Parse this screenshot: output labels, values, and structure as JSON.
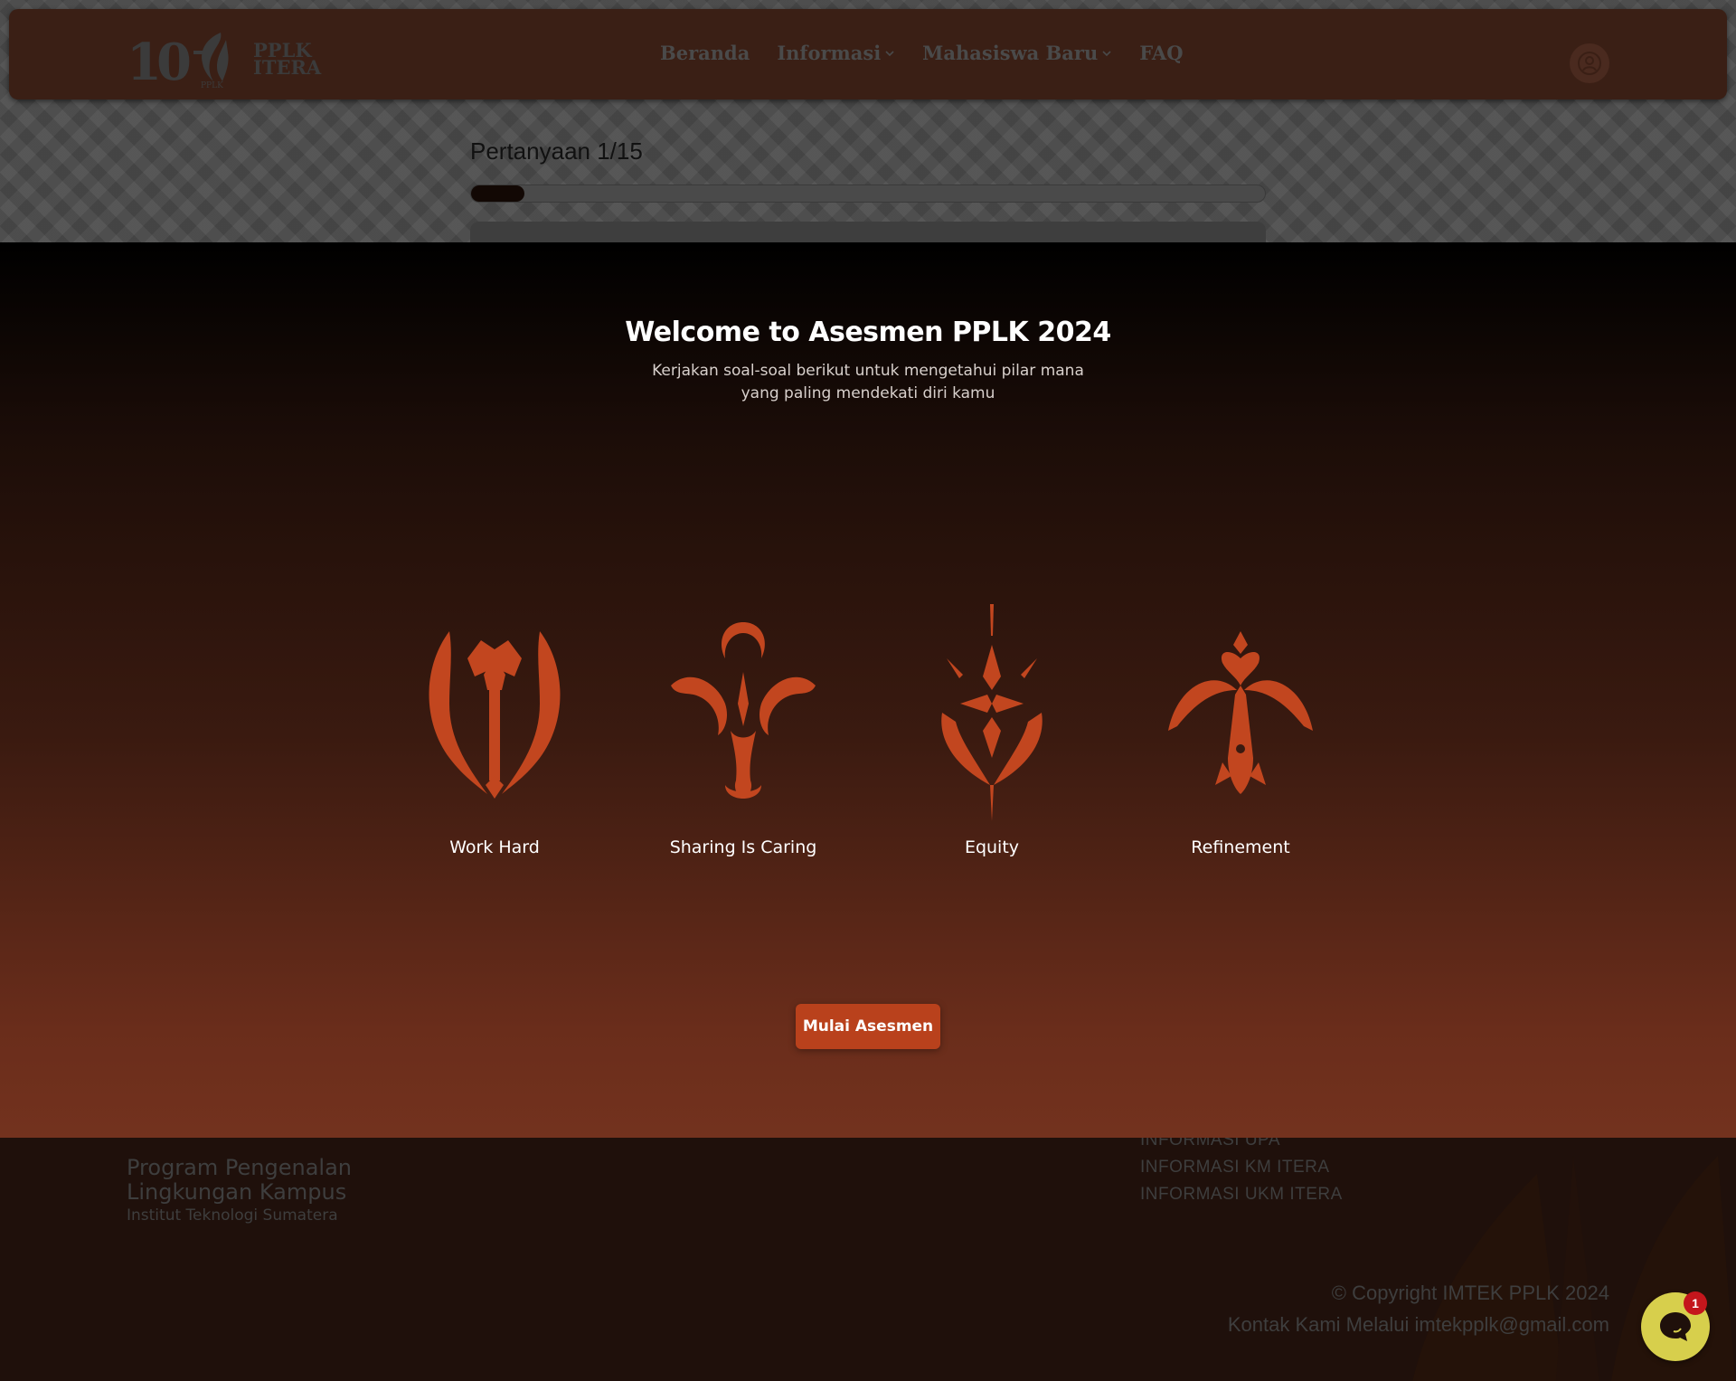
{
  "navbar": {
    "logo_number": "10",
    "logo_emblem_text": "PPLK",
    "logo_word_line1": "PPLK",
    "logo_word_line2": "ITERA",
    "links": [
      {
        "label": "Beranda",
        "has_dropdown": false
      },
      {
        "label": "Informasi",
        "has_dropdown": true
      },
      {
        "label": "Mahasiswa Baru",
        "has_dropdown": true
      },
      {
        "label": "FAQ",
        "has_dropdown": false
      }
    ],
    "avatar_icon": "user-circle-icon"
  },
  "assessment": {
    "question_label": "Pertanyaan 1/15",
    "progress_fraction": 0.0667
  },
  "modal": {
    "title": "Welcome to Asesmen PPLK 2024",
    "subtitle": "Kerjakan soal-soal berikut untuk mengetahui pilar mana yang paling mendekati diri kamu",
    "pillars": [
      {
        "label": "Work Hard",
        "icon": "work-hard-emblem-icon"
      },
      {
        "label": "Sharing Is Caring",
        "icon": "sharing-is-caring-emblem-icon"
      },
      {
        "label": "Equity",
        "icon": "equity-emblem-icon"
      },
      {
        "label": "Refinement",
        "icon": "refinement-emblem-icon"
      }
    ],
    "start_button": "Mulai Asesmen"
  },
  "footer": {
    "title_line1": "Program Pengenalan",
    "title_line2": "Lingkungan Kampus",
    "subtitle": "Institut Teknologi Sumatera",
    "links": [
      "INFORMASI UPA",
      "INFORMASI KM ITERA",
      "INFORMASI UKM ITERA"
    ],
    "copyright": "© Copyright IMTEK PPLK 2024",
    "contact": "Kontak Kami Melalui imtekpplk@gmail.com"
  },
  "chat": {
    "icon": "chat-bubble-icon",
    "badge_count": "1"
  },
  "colors": {
    "accent": "#b9411c",
    "emblem": "#c2461f",
    "navbar_bg": "#3a1f15",
    "chat_bg": "#d7cf4c",
    "badge_bg": "#c4161c"
  }
}
